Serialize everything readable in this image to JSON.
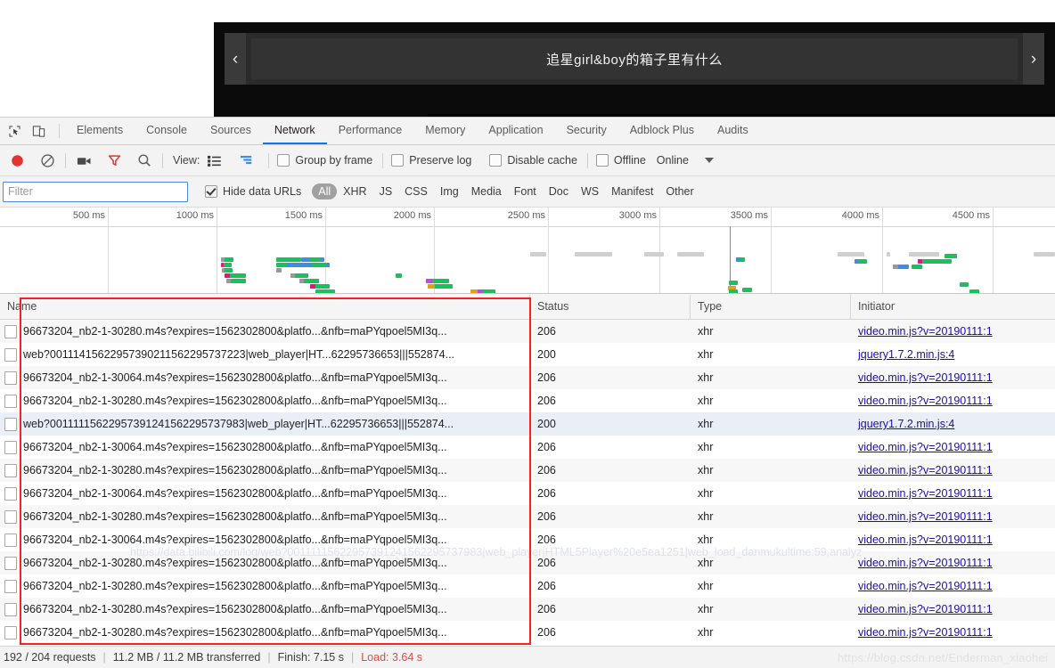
{
  "player": {
    "title": "追星girl&boy的箱子里有什么",
    "prev_label": "‹",
    "next_label": "›"
  },
  "devtools": {
    "tool_icons": [
      {
        "name": "inspect-element-icon",
        "label": "Inspect element"
      },
      {
        "name": "device-toolbar-icon",
        "label": "Toggle device toolbar"
      }
    ],
    "tabs": [
      {
        "label": "Elements",
        "active": false
      },
      {
        "label": "Console",
        "active": false
      },
      {
        "label": "Sources",
        "active": false
      },
      {
        "label": "Network",
        "active": true
      },
      {
        "label": "Performance",
        "active": false
      },
      {
        "label": "Memory",
        "active": false
      },
      {
        "label": "Application",
        "active": false
      },
      {
        "label": "Security",
        "active": false
      },
      {
        "label": "Adblock Plus",
        "active": false
      },
      {
        "label": "Audits",
        "active": false
      }
    ],
    "toolbar": {
      "record_label": "Record",
      "clear_label": "Clear",
      "screenshot_label": "Capture screenshots",
      "filter_toggle_label": "Filter",
      "search_label": "Search",
      "view_label": "View:",
      "view_list_label": "List view",
      "view_waterfall_label": "Waterfall view",
      "group_by_frame": {
        "label": "Group by frame",
        "checked": false
      },
      "preserve_log": {
        "label": "Preserve log",
        "checked": false
      },
      "disable_cache": {
        "label": "Disable cache",
        "checked": false
      },
      "offline": {
        "label": "Offline",
        "checked": false
      },
      "online_label": "Online",
      "throttling_caret": "▼"
    },
    "filterbar": {
      "placeholder": "Filter",
      "value": "",
      "hide_data_urls": {
        "label": "Hide data URLs",
        "checked": true
      },
      "types": [
        {
          "label": "All",
          "selected": true
        },
        {
          "label": "XHR",
          "selected": false
        },
        {
          "label": "JS",
          "selected": false
        },
        {
          "label": "CSS",
          "selected": false
        },
        {
          "label": "Img",
          "selected": false
        },
        {
          "label": "Media",
          "selected": false
        },
        {
          "label": "Font",
          "selected": false
        },
        {
          "label": "Doc",
          "selected": false
        },
        {
          "label": "WS",
          "selected": false
        },
        {
          "label": "Manifest",
          "selected": false
        },
        {
          "label": "Other",
          "selected": false
        }
      ]
    },
    "overview": {
      "ticks": [
        "500 ms",
        "1000 ms",
        "1500 ms",
        "2000 ms",
        "2500 ms",
        "3000 ms",
        "3500 ms",
        "4000 ms",
        "4500 ms"
      ],
      "load_marker_ms": 3640
    },
    "table": {
      "columns": [
        "Name",
        "Status",
        "Type",
        "Initiator"
      ],
      "rows": [
        {
          "name": "96673204_nb2-1-30280.m4s?expires=1562302800&platfo...&nfb=maPYqpoel5MI3q...",
          "status": "206",
          "type": "xhr",
          "initiator": "video.min.js?v=20190111:1"
        },
        {
          "name": "web?00111415622957390211562295737223|web_player|HT...62295736653|||552874...",
          "status": "200",
          "type": "xhr",
          "initiator": "jquery1.7.2.min.js:4"
        },
        {
          "name": "96673204_nb2-1-30064.m4s?expires=1562302800&platfo...&nfb=maPYqpoel5MI3q...",
          "status": "206",
          "type": "xhr",
          "initiator": "video.min.js?v=20190111:1"
        },
        {
          "name": "96673204_nb2-1-30280.m4s?expires=1562302800&platfo...&nfb=maPYqpoel5MI3q...",
          "status": "206",
          "type": "xhr",
          "initiator": "video.min.js?v=20190111:1"
        },
        {
          "name": "web?00111115622957391241562295737983|web_player|HT...62295736653|||552874...",
          "status": "200",
          "type": "xhr",
          "initiator": "jquery1.7.2.min.js:4"
        },
        {
          "name": "96673204_nb2-1-30064.m4s?expires=1562302800&platfo...&nfb=maPYqpoel5MI3q...",
          "status": "206",
          "type": "xhr",
          "initiator": "video.min.js?v=20190111:1"
        },
        {
          "name": "96673204_nb2-1-30280.m4s?expires=1562302800&platfo...&nfb=maPYqpoel5MI3q...",
          "status": "206",
          "type": "xhr",
          "initiator": "video.min.js?v=20190111:1"
        },
        {
          "name": "96673204_nb2-1-30064.m4s?expires=1562302800&platfo...&nfb=maPYqpoel5MI3q...",
          "status": "206",
          "type": "xhr",
          "initiator": "video.min.js?v=20190111:1"
        },
        {
          "name": "96673204_nb2-1-30280.m4s?expires=1562302800&platfo...&nfb=maPYqpoel5MI3q...",
          "status": "206",
          "type": "xhr",
          "initiator": "video.min.js?v=20190111:1"
        },
        {
          "name": "96673204_nb2-1-30064.m4s?expires=1562302800&platfo...&nfb=maPYqpoel5MI3q...",
          "status": "206",
          "type": "xhr",
          "initiator": "video.min.js?v=20190111:1"
        },
        {
          "name": "96673204_nb2-1-30280.m4s?expires=1562302800&platfo...&nfb=maPYqpoel5MI3q...",
          "status": "206",
          "type": "xhr",
          "initiator": "video.min.js?v=20190111:1"
        },
        {
          "name": "96673204_nb2-1-30280.m4s?expires=1562302800&platfo...&nfb=maPYqpoel5MI3q...",
          "status": "206",
          "type": "xhr",
          "initiator": "video.min.js?v=20190111:1"
        },
        {
          "name": "96673204_nb2-1-30280.m4s?expires=1562302800&platfo...&nfb=maPYqpoel5MI3q...",
          "status": "206",
          "type": "xhr",
          "initiator": "video.min.js?v=20190111:1"
        },
        {
          "name": "96673204_nb2-1-30280.m4s?expires=1562302800&platfo...&nfb=maPYqpoel5MI3q...",
          "status": "206",
          "type": "xhr",
          "initiator": "video.min.js?v=20190111:1"
        }
      ]
    },
    "ghost_url": "https://data.bilibili.com/log/web?00111115622957391241562295737983|web_player|HTML5Player%20e5ea1251|web_load_danmukultime:59,analyz",
    "statusbar": {
      "requests": "192 / 204 requests",
      "transferred": "11.2 MB / 11.2 MB transferred",
      "finish": "Finish: 7.15 s",
      "load": "Load: 3.64 s",
      "separator": "|"
    }
  },
  "watermark": "https://blog.csdn.net/Enderman_xiaohei",
  "colors": {
    "accent": "#1a73e8",
    "record": "#e3342f",
    "filter_active": "#e3342f",
    "link": "#1a0dab",
    "load_red": "#e8483f",
    "annotation_box": "#f5231f"
  }
}
